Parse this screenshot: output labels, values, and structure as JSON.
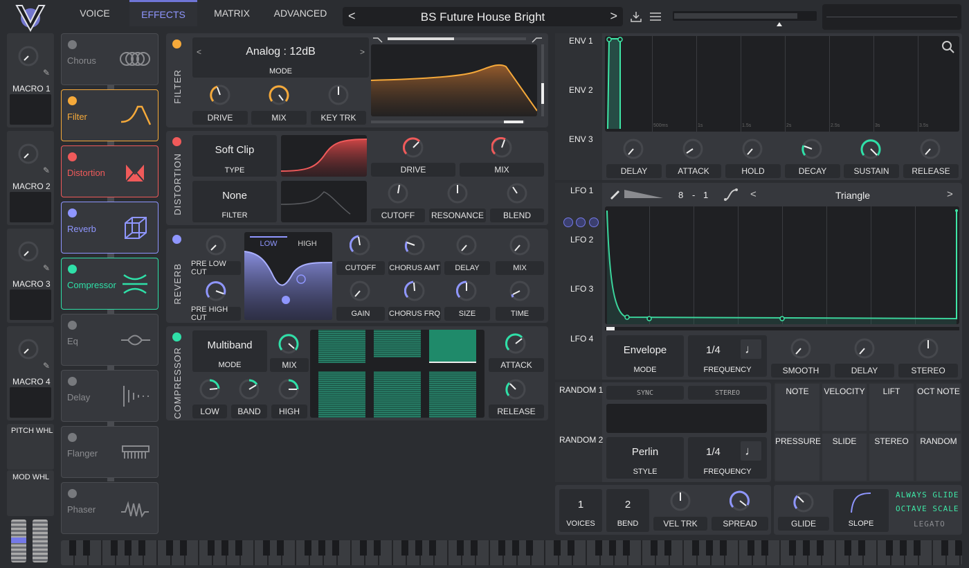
{
  "nav": {
    "tabs": [
      "VOICE",
      "EFFECTS",
      "MATRIX",
      "ADVANCED"
    ],
    "active": "EFFECTS"
  },
  "preset": {
    "name": "BS Future House Bright",
    "prev": "<",
    "next": ">"
  },
  "macros": [
    {
      "label": "MACRO 1"
    },
    {
      "label": "MACRO 2"
    },
    {
      "label": "MACRO 3"
    },
    {
      "label": "MACRO 4"
    }
  ],
  "wheels": {
    "pitch": "PITCH WHL",
    "mod": "MOD WHL"
  },
  "fx": [
    {
      "name": "Chorus",
      "on": false,
      "color": "#8a8b8f"
    },
    {
      "name": "Filter",
      "on": true,
      "color": "#f5a93a"
    },
    {
      "name": "Distortion",
      "on": true,
      "color": "#f05a5a"
    },
    {
      "name": "Reverb",
      "on": true,
      "color": "#8f96ff"
    },
    {
      "name": "Compressor",
      "on": true,
      "color": "#2fe0a8"
    },
    {
      "name": "Eq",
      "on": false,
      "color": "#8a8b8f"
    },
    {
      "name": "Delay",
      "on": false,
      "color": "#8a8b8f"
    },
    {
      "name": "Flanger",
      "on": false,
      "color": "#8a8b8f"
    },
    {
      "name": "Phaser",
      "on": false,
      "color": "#8a8b8f"
    }
  ],
  "filter": {
    "section": "FILTER",
    "model": "Analog",
    "sep": ":",
    "slope": "12dB",
    "mode_label": "MODE",
    "knobs": [
      "DRIVE",
      "MIX",
      "KEY TRK"
    ],
    "color": "#f5a93a"
  },
  "distortion": {
    "section": "DISTORTION",
    "type": "Soft Clip",
    "type_label": "TYPE",
    "filter": "None",
    "filter_label": "FILTER",
    "knobs": [
      "DRIVE",
      "MIX",
      "CUTOFF",
      "RESONANCE",
      "BLEND"
    ],
    "color": "#f05a5a"
  },
  "reverb": {
    "section": "REVERB",
    "low": "LOW",
    "high": "HIGH",
    "knobs": [
      "PRE LOW CUT",
      "PRE HIGH CUT",
      "CUTOFF",
      "CHORUS AMT",
      "DELAY",
      "MIX",
      "GAIN",
      "CHORUS FRQ",
      "SIZE",
      "TIME"
    ],
    "color": "#8f96ff"
  },
  "compressor": {
    "section": "COMPRESSOR",
    "mode": "Multiband",
    "mode_label": "MODE",
    "knobs": [
      "MIX",
      "LOW",
      "BAND",
      "HIGH",
      "ATTACK",
      "RELEASE"
    ],
    "color": "#2fe0a8"
  },
  "env": {
    "labels": [
      "ENV 1",
      "ENV 2",
      "ENV 3"
    ],
    "ticks": [
      "500ms",
      "1s",
      "1.5s",
      "2s",
      "2.5s",
      "3s",
      "3.5s"
    ],
    "knobs": [
      "DELAY",
      "ATTACK",
      "HOLD",
      "DECAY",
      "SUSTAIN",
      "RELEASE"
    ]
  },
  "lfo": {
    "labels": [
      "LFO 1",
      "LFO 2",
      "LFO 3",
      "LFO 4"
    ],
    "rate_num": "8",
    "rate_sep": "-",
    "rate_den": "1",
    "shape": "Triangle",
    "mode": "Envelope",
    "mode_label": "MODE",
    "freq": "1/4",
    "freq_label": "FREQUENCY",
    "knobs": [
      "SMOOTH",
      "DELAY",
      "STEREO"
    ]
  },
  "random": {
    "labels": [
      "RANDOM 1",
      "RANDOM 2"
    ],
    "sync": "SYNC",
    "stereo": "STEREO",
    "style": "Perlin",
    "style_label": "STYLE",
    "freq": "1/4",
    "freq_label": "FREQUENCY"
  },
  "mod_sources": [
    "NOTE",
    "VELOCITY",
    "LIFT",
    "OCT NOTE",
    "PRESSURE",
    "SLIDE",
    "STEREO",
    "RANDOM"
  ],
  "voice": {
    "voices": "1",
    "voices_label": "VOICES",
    "bend": "2",
    "bend_label": "BEND",
    "vel_trk": "VEL TRK",
    "spread": "SPREAD",
    "glide": "GLIDE",
    "slope": "SLOPE",
    "always_glide": "ALWAYS GLIDE",
    "octave_scale": "OCTAVE SCALE",
    "legato": "LEGATO"
  }
}
